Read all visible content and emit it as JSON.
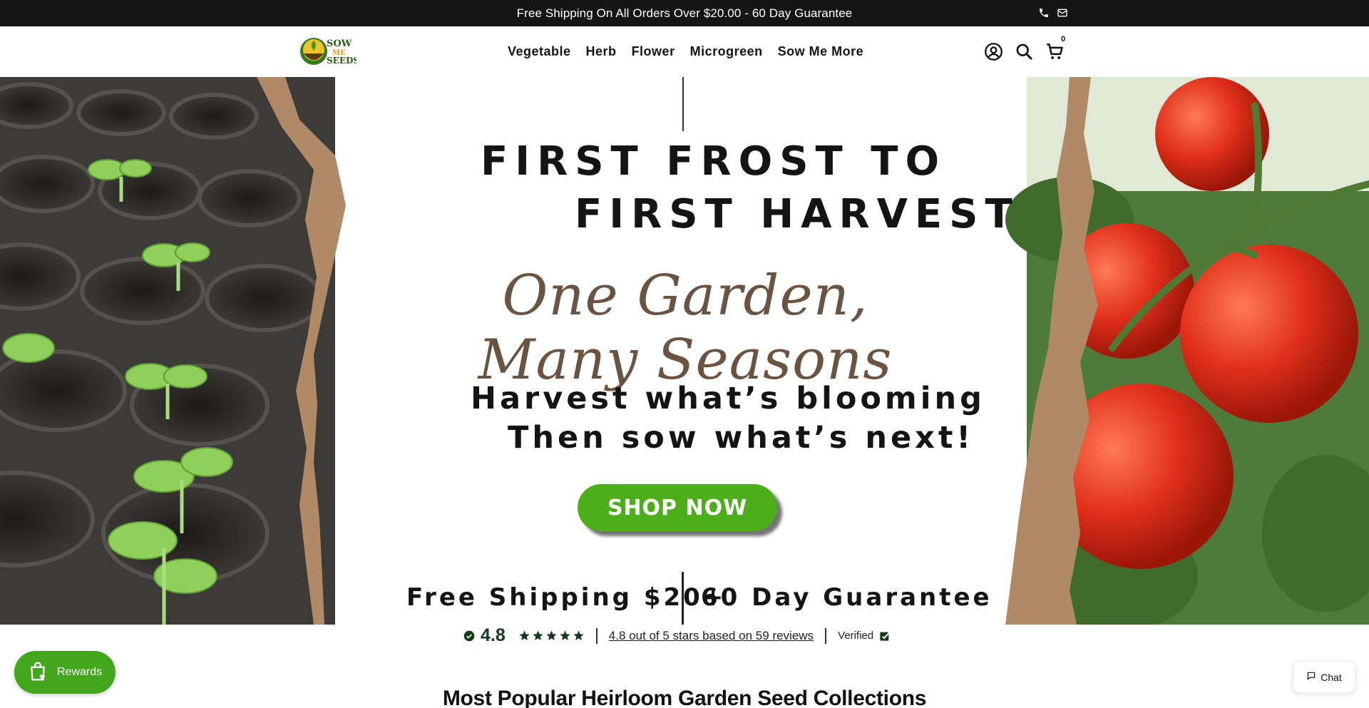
{
  "announcement": {
    "text": "Free Shipping On All Orders Over $20.00 - 60 Day Guarantee",
    "icons": [
      "phone-icon",
      "mail-icon"
    ]
  },
  "header": {
    "logo_text": [
      "SOW",
      "ME",
      "SEEDS"
    ],
    "nav": [
      "Vegetable",
      "Herb",
      "Flower",
      "Microgreen",
      "Sow Me More"
    ],
    "icons": [
      "account-icon",
      "search-icon",
      "cart-icon"
    ],
    "cart_count": "0"
  },
  "hero": {
    "headline_line1": "FIRST FROST TO",
    "headline_line2": "FIRST HARVEST",
    "script_tagline": "One Garden, Many Seasons",
    "sub_line1": "Harvest what’s blooming",
    "sub_line2": "Then sow what’s next!",
    "cta_label": "SHOP NOW",
    "benefit_left": "Free Shipping $20+",
    "benefit_right": "60 Day Guarantee",
    "colors": {
      "cta": "#4caf19",
      "script": "#6a5340",
      "kraft": "#b08a66"
    }
  },
  "reviews": {
    "score": "4.8",
    "stars": 5,
    "summary_link": "4.8 out of 5 stars based on 59 reviews",
    "verified_label": "Verified",
    "color": "#163b1a"
  },
  "section": {
    "title": "Most Popular Heirloom Garden Seed Collections"
  },
  "widgets": {
    "rewards_label": "Rewards",
    "chat_label": "Chat"
  }
}
